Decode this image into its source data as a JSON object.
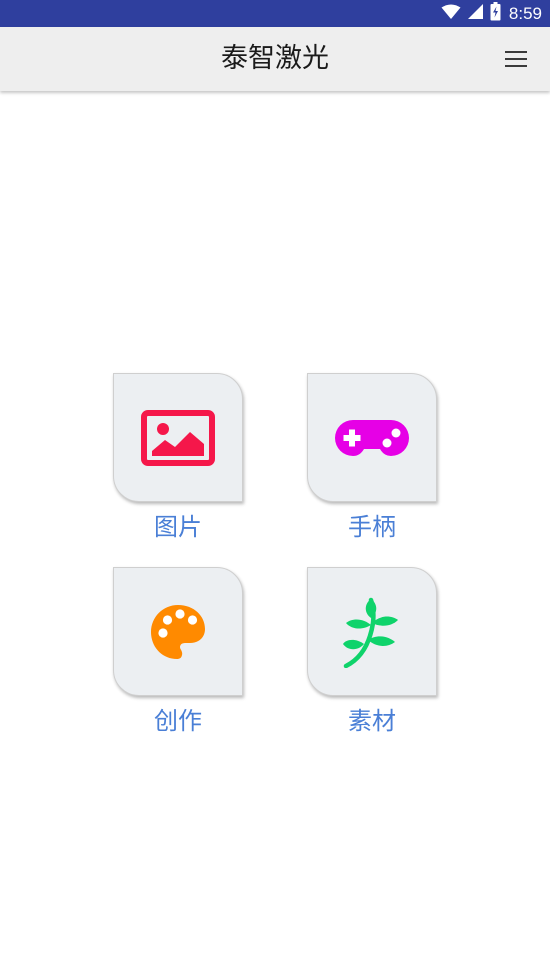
{
  "status_bar": {
    "time": "8:59",
    "icons": [
      "wifi-icon",
      "signal-icon",
      "battery-icon"
    ]
  },
  "app_bar": {
    "title": "泰智激光",
    "menu_icon": "hamburger-menu-icon"
  },
  "grid": [
    {
      "label": "图片",
      "icon": "image-icon",
      "color": "#f5174a"
    },
    {
      "label": "手柄",
      "icon": "gamepad-icon",
      "color": "#e600e6"
    },
    {
      "label": "创作",
      "icon": "palette-icon",
      "color": "#ff8a00"
    },
    {
      "label": "素材",
      "icon": "leaf-icon",
      "color": "#0fd36b"
    }
  ],
  "colors": {
    "status_bar": "#2f3f9e",
    "app_bar": "#eeeeee",
    "label_text": "#4a7fd6",
    "tile_background": "#eceff2"
  }
}
